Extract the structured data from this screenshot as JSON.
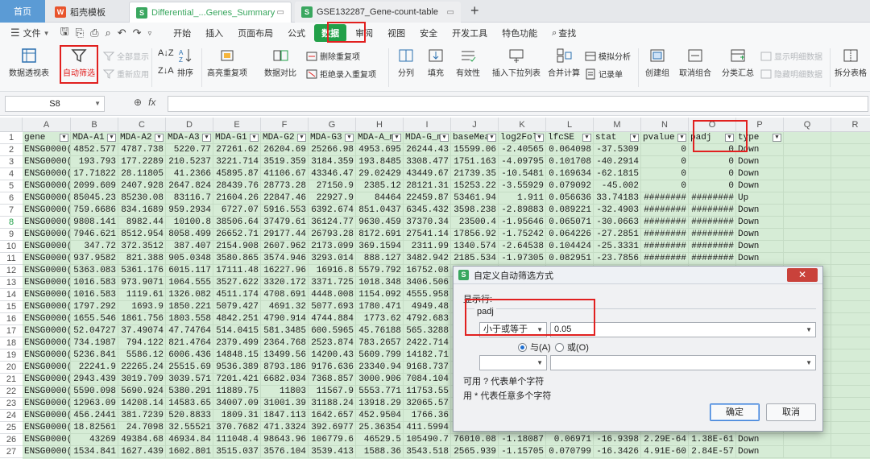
{
  "tabs": {
    "home": "首页",
    "template": "稻壳模板",
    "doc1": "Differential_...Genes_Summary",
    "doc2": "GSE132287_Gene-count-table",
    "new_tab": "+"
  },
  "menu": {
    "file": "文件",
    "items": [
      "开始",
      "插入",
      "页面布局",
      "公式",
      "数据",
      "审阅",
      "视图",
      "安全",
      "开发工具",
      "特色功能"
    ],
    "active_item": "数据",
    "search": "查找"
  },
  "ribbon": {
    "pivot": "数据透视表",
    "autofilter": "自动筛选",
    "show_all": "全部显示",
    "reapply": "重新应用",
    "sort": "排序",
    "highlight_dup": "高亮重复项",
    "compare": "数据对比",
    "remove_dup": "删除重复项",
    "reject_dup": "拒绝录入重复项",
    "split": "分列",
    "fill": "填充",
    "validity": "有效性",
    "dropdown": "插入下拉列表",
    "consolidate": "合并计算",
    "simulate": "模拟分析",
    "record": "记录单",
    "group": "创建组",
    "ungroup": "取消组合",
    "subtotal": "分类汇总",
    "show_detail": "显示明细数据",
    "hide_detail": "隐藏明细数据",
    "split_table": "拆分表格"
  },
  "formula": {
    "cell_ref": "S8",
    "fx": "fx",
    "content": ""
  },
  "columns": [
    "A",
    "B",
    "C",
    "D",
    "E",
    "F",
    "G",
    "H",
    "I",
    "J",
    "K",
    "L",
    "M",
    "N",
    "O",
    "P",
    "Q",
    "R"
  ],
  "rows": [
    "1",
    "2",
    "3",
    "4",
    "5",
    "6",
    "7",
    "8",
    "9",
    "10",
    "11",
    "12",
    "13",
    "14",
    "15",
    "16",
    "17",
    "18",
    "19",
    "20",
    "21",
    "22",
    "23",
    "24",
    "25",
    "26",
    "27"
  ],
  "headers": [
    "gene",
    "MDA-A1",
    "MDA-A2",
    "MDA-A3",
    "MDA-G1",
    "MDA-G2",
    "MDA-G3",
    "MDA-A_m",
    "MDA-G_m",
    "baseMea",
    "log2Fol",
    "lfcSE",
    "stat",
    "pvalue",
    "padj",
    "type"
  ],
  "data": [
    [
      "ENSG0000(",
      "4852.577",
      "4787.738",
      "5220.77",
      "27261.62",
      "26204.69",
      "25266.98",
      "4953.695",
      "26244.43",
      "15599.06",
      "-2.40565",
      "0.064098",
      "-37.5309",
      "0",
      "0",
      "Down"
    ],
    [
      "ENSG0000(",
      "193.793",
      "177.2289",
      "210.5237",
      "3221.714",
      "3519.359",
      "3184.359",
      "193.8485",
      "3308.477",
      "1751.163",
      "-4.09795",
      "0.101708",
      "-40.2914",
      "0",
      "0",
      "Down"
    ],
    [
      "ENSG0000(",
      "17.71822",
      "28.11805",
      "41.2366",
      "45895.87",
      "41106.67",
      "43346.47",
      "29.02429",
      "43449.67",
      "21739.35",
      "-10.5481",
      "0.169634",
      "-62.1815",
      "0",
      "0",
      "Down"
    ],
    [
      "ENSG0000(",
      "2099.609",
      "2407.928",
      "2647.824",
      "28439.76",
      "28773.28",
      "27150.9",
      "2385.12",
      "28121.31",
      "15253.22",
      "-3.55929",
      "0.079092",
      "-45.002",
      "0",
      "0",
      "Down"
    ],
    [
      "ENSG0000(",
      "85045.23",
      "85230.08",
      "83116.7",
      "21604.26",
      "22847.46",
      "22927.9",
      "84464",
      "22459.87",
      "53461.94",
      "1.911",
      "0.056636",
      "33.74183",
      "########",
      "########",
      "Up"
    ],
    [
      "ENSG0000(",
      "759.6686",
      "834.1689",
      "959.2934",
      "6727.07",
      "5916.553",
      "6392.674",
      "851.0437",
      "6345.432",
      "3598.238",
      "-2.89883",
      "0.089221",
      "-32.4903",
      "########",
      "########",
      "Down"
    ],
    [
      "ENSG0000(",
      "9808.141",
      "8982.44",
      "10100.8",
      "38506.64",
      "37479.61",
      "36124.77",
      "9630.459",
      "37370.34",
      "23500.4",
      "-1.95646",
      "0.065071",
      "-30.0663",
      "########",
      "########",
      "Down"
    ],
    [
      "ENSG0000(",
      "7946.621",
      "8512.954",
      "8058.499",
      "26652.71",
      "29177.44",
      "26793.28",
      "8172.691",
      "27541.14",
      "17856.92",
      "-1.75242",
      "0.064226",
      "-27.2851",
      "########",
      "########",
      "Down"
    ],
    [
      "ENSG0000(",
      "347.72",
      "372.3512",
      "387.407",
      "2154.908",
      "2607.962",
      "2173.099",
      "369.1594",
      "2311.99",
      "1340.574",
      "-2.64538",
      "0.104424",
      "-25.3331",
      "########",
      "########",
      "Down"
    ],
    [
      "ENSG0000(",
      "937.9582",
      "821.388",
      "905.0348",
      "3580.865",
      "3574.946",
      "3293.014",
      "888.127",
      "3482.942",
      "2185.534",
      "-1.97305",
      "0.082951",
      "-23.7856",
      "########",
      "########",
      "Down"
    ],
    [
      "ENSG0000(",
      "5363.083",
      "5361.176",
      "6015.117",
      "17111.48",
      "16227.96",
      "16916.8",
      "5579.792",
      "16752.08",
      "",
      "",
      "",
      "",
      "",
      "",
      ""
    ],
    [
      "ENSG0000(",
      "1016.583",
      "973.9071",
      "1064.555",
      "3527.622",
      "3320.172",
      "3371.725",
      "1018.348",
      "3406.506",
      "",
      "",
      "",
      "",
      "",
      "",
      ""
    ],
    [
      "ENSG0000(",
      "1016.583",
      "1119.61",
      "1326.082",
      "4511.174",
      "4708.691",
      "4448.008",
      "1154.092",
      "4555.958",
      "",
      "",
      "",
      "",
      "",
      "",
      ""
    ],
    [
      "ENSG0000(",
      "1797.292",
      "1693.9",
      "1850.221",
      "5079.427",
      "4691.32",
      "5077.693",
      "1780.471",
      "4949.48",
      "",
      "",
      "",
      "",
      "",
      "",
      ""
    ],
    [
      "ENSG0000(",
      "1655.546",
      "1861.756",
      "1803.558",
      "4842.251",
      "4790.914",
      "4744.884",
      "1773.62",
      "4792.683",
      "",
      "",
      "",
      "",
      "",
      "",
      ""
    ],
    [
      "ENSG0000(",
      "52.04727",
      "37.49074",
      "47.74764",
      "514.0415",
      "581.3485",
      "600.5965",
      "45.76188",
      "565.3288",
      "",
      "",
      "",
      "",
      "",
      "",
      ""
    ],
    [
      "ENSG0000(",
      "734.1987",
      "794.122",
      "821.4764",
      "2379.499",
      "2364.768",
      "2523.874",
      "783.2657",
      "2422.714",
      "",
      "",
      "",
      "",
      "",
      "",
      ""
    ],
    [
      "ENSG0000(",
      "5236.841",
      "5586.12",
      "6006.436",
      "14848.15",
      "13499.56",
      "14200.43",
      "5609.799",
      "14182.71",
      "",
      "",
      "",
      "",
      "",
      "",
      ""
    ],
    [
      "ENSG0000(",
      "22241.9",
      "22265.24",
      "25515.69",
      "9536.389",
      "8793.186",
      "9176.636",
      "23340.94",
      "9168.737",
      "",
      "",
      "",
      "",
      "",
      "",
      ""
    ],
    [
      "ENSG0000(",
      "2943.439",
      "3019.709",
      "3039.571",
      "7201.421",
      "6682.034",
      "7368.857",
      "3000.906",
      "7084.104",
      "",
      "",
      "",
      "",
      "",
      "",
      ""
    ],
    [
      "ENSG0000(",
      "5590.098",
      "5690.924",
      "5380.291",
      "11889.75",
      "11803",
      "11567.9",
      "5553.771",
      "11753.55",
      "",
      "",
      "",
      "",
      "",
      "",
      ""
    ],
    [
      "ENSG0000(",
      "12963.09",
      "14208.14",
      "14583.65",
      "34007.09",
      "31001.39",
      "31188.24",
      "13918.29",
      "32065.57",
      "",
      "",
      "",
      "",
      "",
      "",
      ""
    ],
    [
      "ENSG0000(",
      "456.2441",
      "381.7239",
      "520.8833",
      "1809.31",
      "1847.113",
      "1642.657",
      "452.9504",
      "1766.36",
      "",
      "",
      "",
      "",
      "",
      "",
      ""
    ],
    [
      "ENSG0000(",
      "18.82561",
      "24.7098",
      "32.55521",
      "370.7682",
      "471.3324",
      "392.6977",
      "25.36354",
      "411.5994",
      "",
      "",
      "",
      "",
      "",
      "",
      ""
    ],
    [
      "ENSG0000(",
      "43269",
      "49384.68",
      "46934.84",
      "111048.4",
      "98643.96",
      "106779.6",
      "46529.5",
      "105490.7",
      "76010.08",
      "-1.18087",
      "0.06971",
      "-16.9398",
      "2.29E-64",
      "1.38E-61",
      "Down"
    ],
    [
      "ENSG0000(",
      "1534.841",
      "1627.439",
      "1602.801",
      "3515.037",
      "3576.104",
      "3539.413",
      "1588.36",
      "3543.518",
      "2565.939",
      "-1.15705",
      "0.070799",
      "-16.3426",
      "4.91E-60",
      "2.84E-57",
      "Down"
    ]
  ],
  "dialog": {
    "title": "自定义自动筛选方式",
    "show_rows": "显示行:",
    "field": "padj",
    "operator1": "小于或等于",
    "value1": "0.05",
    "and_label": "与(A)",
    "or_label": "或(O)",
    "operator2": "",
    "value2": "",
    "hint1": "可用 ? 代表单个字符",
    "hint2": "用 * 代表任意多个字符",
    "ok": "确定",
    "cancel": "取消",
    "close": "✕"
  }
}
